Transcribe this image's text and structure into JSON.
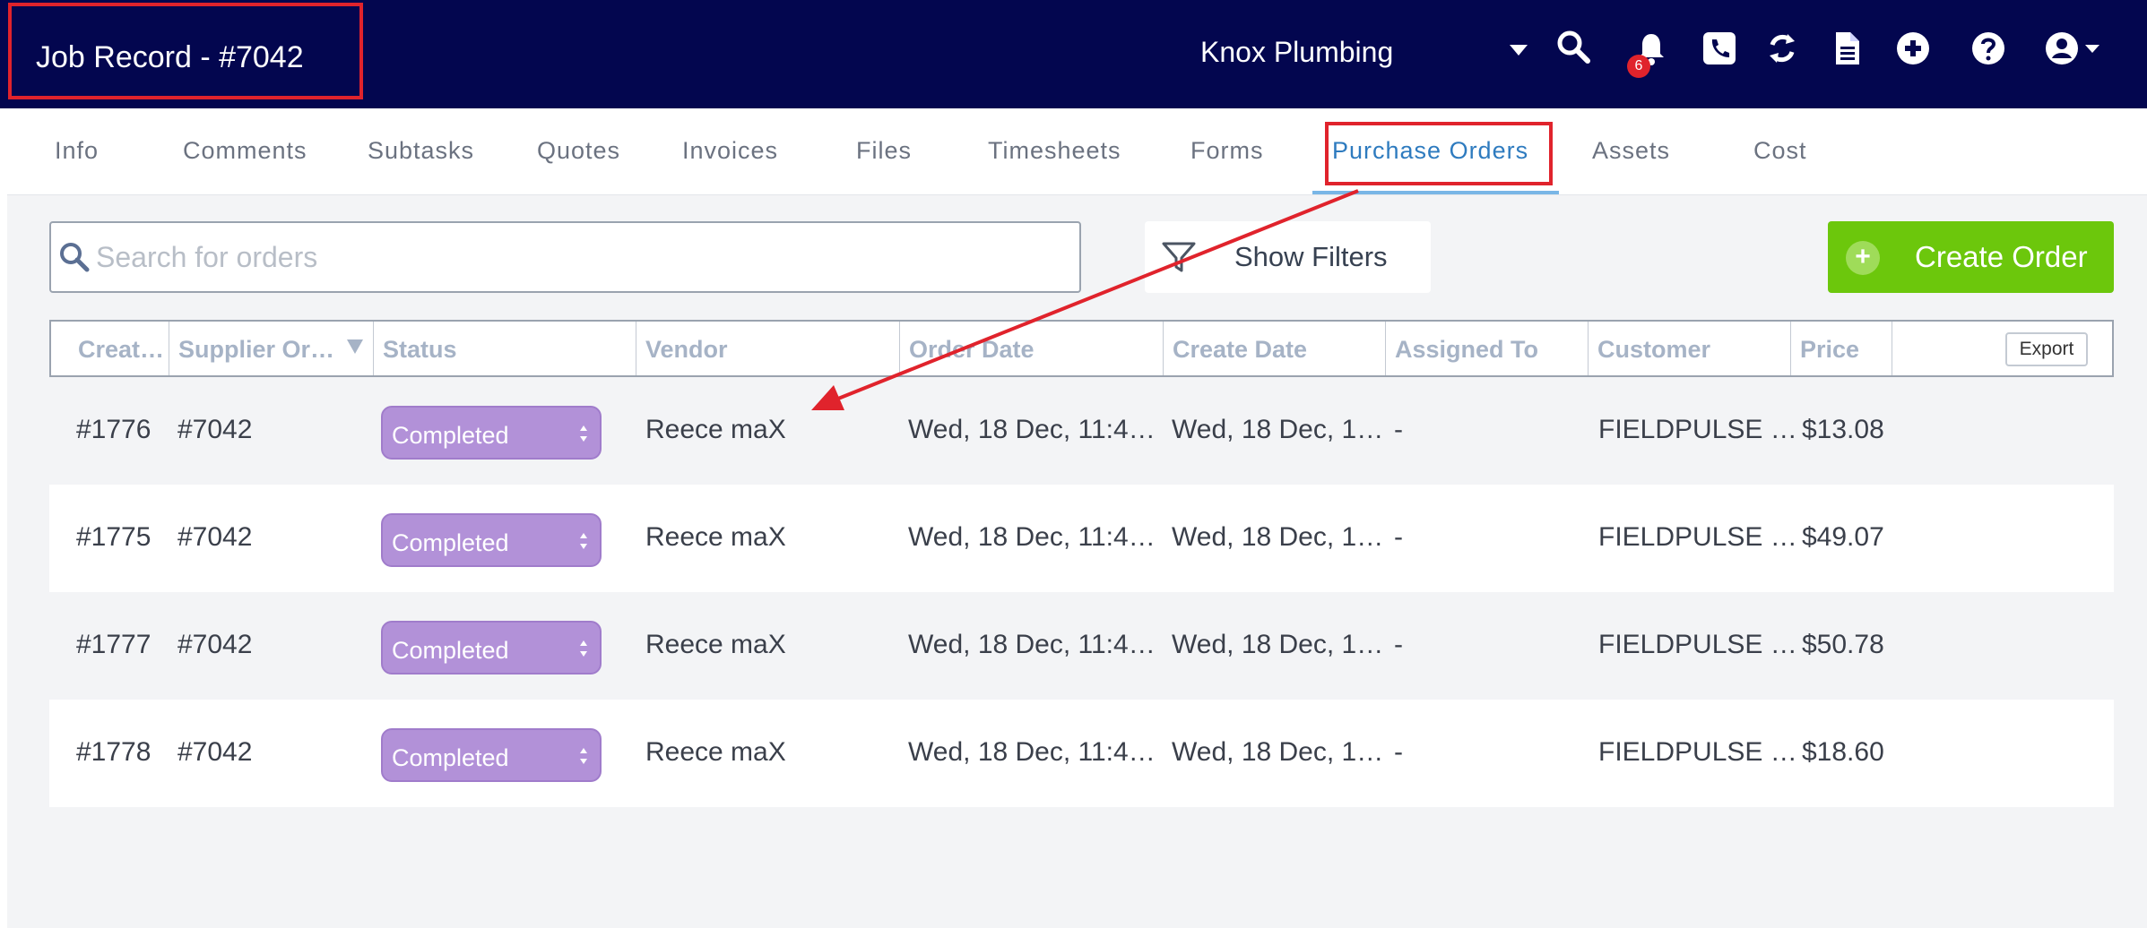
{
  "header": {
    "job_title": "Job Record - #7042",
    "company": "Knox Plumbing",
    "notification_count": "6",
    "icons": [
      "caret-down-icon",
      "search-icon",
      "bell-icon",
      "phone-icon",
      "sync-icon",
      "document-icon",
      "add-circle-icon",
      "help-icon",
      "user-account-icon"
    ]
  },
  "tabs": [
    {
      "label": "Info"
    },
    {
      "label": "Comments"
    },
    {
      "label": "Subtasks"
    },
    {
      "label": "Quotes"
    },
    {
      "label": "Invoices"
    },
    {
      "label": "Files"
    },
    {
      "label": "Timesheets"
    },
    {
      "label": "Forms"
    },
    {
      "label": "Purchase Orders",
      "active": true
    },
    {
      "label": "Assets"
    },
    {
      "label": "Cost"
    }
  ],
  "toolbar": {
    "search_placeholder": "Search for orders",
    "filters_label": "Show Filters",
    "create_label": "Create Order",
    "export_label": "Export"
  },
  "table": {
    "columns": [
      "Creat…",
      "Supplier Or…",
      "Status",
      "Vendor",
      "Order Date",
      "Create Date",
      "Assigned To",
      "Customer",
      "Price"
    ],
    "rows": [
      {
        "id": "#1776",
        "supplier_order": "#7042",
        "status": "Completed",
        "vendor": "Reece maX",
        "order_date": "Wed, 18 Dec, 11:4…",
        "create_date": "Wed, 18 Dec, 1…",
        "assigned_to": "-",
        "customer": "FIELDPULSE …",
        "price": "$13.08"
      },
      {
        "id": "#1775",
        "supplier_order": "#7042",
        "status": "Completed",
        "vendor": "Reece maX",
        "order_date": "Wed, 18 Dec, 11:4…",
        "create_date": "Wed, 18 Dec, 1…",
        "assigned_to": "-",
        "customer": "FIELDPULSE …",
        "price": "$49.07"
      },
      {
        "id": "#1777",
        "supplier_order": "#7042",
        "status": "Completed",
        "vendor": "Reece maX",
        "order_date": "Wed, 18 Dec, 11:4…",
        "create_date": "Wed, 18 Dec, 1…",
        "assigned_to": "-",
        "customer": "FIELDPULSE …",
        "price": "$50.78"
      },
      {
        "id": "#1778",
        "supplier_order": "#7042",
        "status": "Completed",
        "vendor": "Reece maX",
        "order_date": "Wed, 18 Dec, 11:4…",
        "create_date": "Wed, 18 Dec, 1…",
        "assigned_to": "-",
        "customer": "FIELDPULSE …",
        "price": "$18.60"
      }
    ]
  },
  "colors": {
    "header_bg": "#03064f",
    "active_tab": "#2e7bbf",
    "create_button": "#6cc70c",
    "status_badge": "#b291d8",
    "annotation": "#e0232c"
  }
}
